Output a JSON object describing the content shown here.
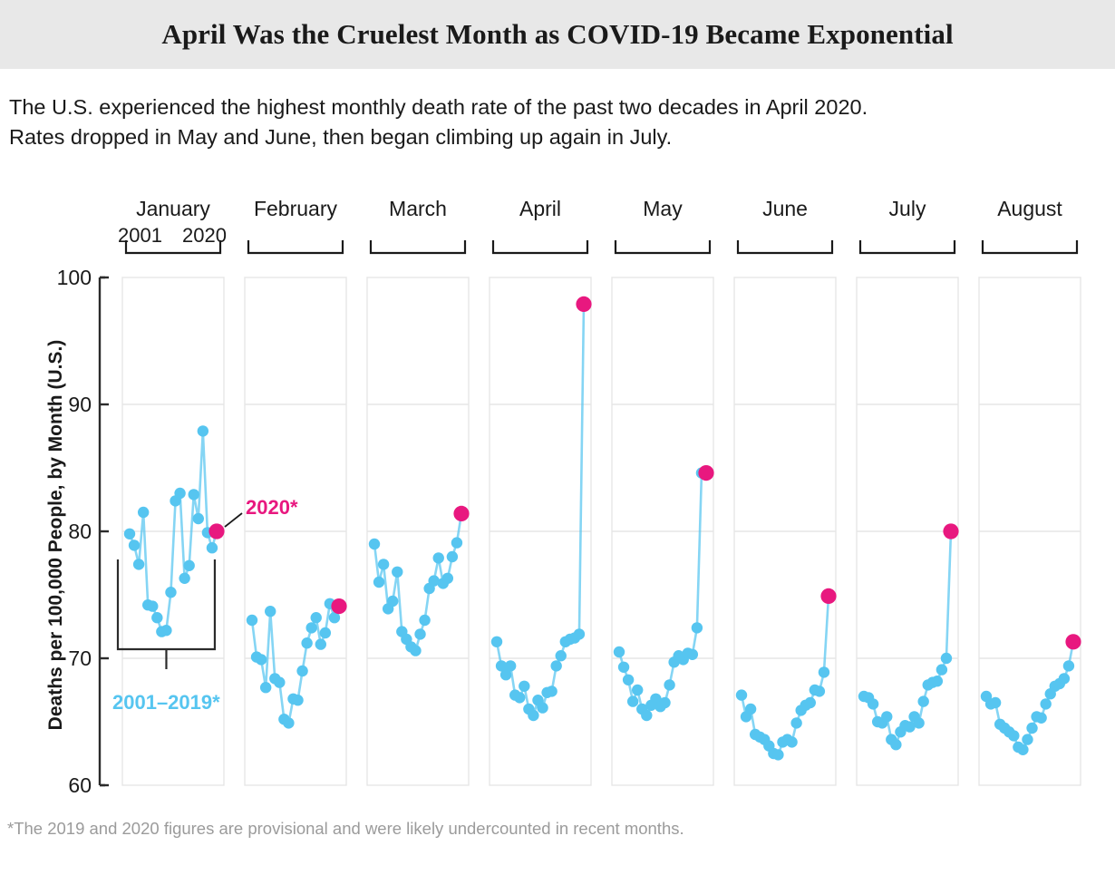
{
  "header": {
    "title": "April Was the Cruelest Month as COVID-19 Became Exponential"
  },
  "deck": {
    "line1": "The U.S. experienced the highest monthly death rate of the past two decades in April 2020.",
    "line2": "Rates dropped in May and June, then began climbing up again in July."
  },
  "footnote": {
    "text": "*The 2019 and 2020 figures are provisional and were likely undercounted in recent months."
  },
  "axis": {
    "y_title": "Deaths per 100,000 People, by Month (U.S.)",
    "y_ticks": [
      "100",
      "90",
      "80",
      "70",
      "60"
    ],
    "year_start_label": "2001",
    "year_end_label": "2020"
  },
  "annotations": {
    "highlight_label": "2020*",
    "range_label": "2001–2019*"
  },
  "colors": {
    "historical": "#56c5f0",
    "highlight": "#e8187f",
    "title_band": "#e8e8e8",
    "grid": "#e6e6e6",
    "axis": "#2b2b2b",
    "footnote": "#9b9b9b"
  },
  "chart_data": {
    "type": "line",
    "title": "April Was the Cruelest Month as COVID-19 Became Exponential",
    "subtitle": "The U.S. experienced the highest monthly death rate of the past two decades in April 2020. Rates dropped in May and June, then began climbing up again in July.",
    "xlabel": "",
    "ylabel": "Deaths per 100,000 People, by Month (U.S.)",
    "ylim": [
      60,
      100
    ],
    "yticks": [
      60,
      70,
      80,
      90,
      100
    ],
    "grid": "horizontal",
    "legend": "none",
    "x": [
      2001,
      2002,
      2003,
      2004,
      2005,
      2006,
      2007,
      2008,
      2009,
      2010,
      2011,
      2012,
      2013,
      2014,
      2015,
      2016,
      2017,
      2018,
      2019,
      2020
    ],
    "panels": [
      {
        "month": "January",
        "values": [
          79.8,
          78.9,
          77.4,
          81.5,
          74.2,
          74.1,
          73.2,
          72.1,
          72.2,
          75.2,
          82.4,
          83.0,
          76.3,
          77.3,
          82.9,
          81.0,
          87.9,
          79.9,
          78.7
        ],
        "highlight_year": 2020,
        "highlight_value": 80.0
      },
      {
        "month": "February",
        "values": [
          73.0,
          70.1,
          69.9,
          67.7,
          73.7,
          68.4,
          68.1,
          65.2,
          64.9,
          66.8,
          66.7,
          69.0,
          71.2,
          72.4,
          73.2,
          71.1,
          72.0,
          74.3,
          73.2
        ],
        "highlight_year": 2020,
        "highlight_value": 74.1
      },
      {
        "month": "March",
        "values": [
          79.0,
          76.0,
          77.4,
          73.9,
          74.5,
          76.8,
          72.1,
          71.5,
          70.9,
          70.6,
          71.9,
          73.0,
          75.5,
          76.1,
          77.9,
          75.9,
          76.3,
          78.0,
          79.1
        ],
        "highlight_year": 2020,
        "highlight_value": 81.4
      },
      {
        "month": "April",
        "values": [
          71.3,
          69.4,
          68.7,
          69.4,
          67.1,
          66.9,
          67.8,
          66.0,
          65.5,
          66.7,
          66.1,
          67.3,
          67.4,
          69.4,
          70.2,
          71.3,
          71.5,
          71.6,
          71.9
        ],
        "highlight_year": 2020,
        "highlight_value": 97.9
      },
      {
        "month": "May",
        "values": [
          70.5,
          69.3,
          68.3,
          66.6,
          67.5,
          66.0,
          65.5,
          66.3,
          66.8,
          66.2,
          66.5,
          67.9,
          69.7,
          70.2,
          69.9,
          70.4,
          70.3,
          72.4,
          84.6
        ],
        "highlight_year": 2020,
        "highlight_value": 84.6
      },
      {
        "month": "June",
        "values": [
          67.1,
          65.4,
          66.0,
          64.0,
          63.8,
          63.6,
          63.1,
          62.5,
          62.4,
          63.4,
          63.6,
          63.4,
          64.9,
          65.9,
          66.3,
          66.5,
          67.5,
          67.4,
          68.9
        ],
        "highlight_year": 2020,
        "highlight_value": 74.9
      },
      {
        "month": "July",
        "values": [
          67.0,
          66.9,
          66.4,
          65.0,
          64.9,
          65.4,
          63.6,
          63.2,
          64.2,
          64.7,
          64.6,
          65.4,
          64.9,
          66.6,
          67.9,
          68.1,
          68.2,
          69.1,
          70.0
        ],
        "highlight_year": 2020,
        "highlight_value": 80.0
      },
      {
        "month": "August",
        "values": [
          67.0,
          66.4,
          66.5,
          64.8,
          64.5,
          64.2,
          63.9,
          63.0,
          62.8,
          63.6,
          64.5,
          65.4,
          65.3,
          66.4,
          67.2,
          67.8,
          68.0,
          68.4,
          69.4
        ],
        "highlight_year": 2020,
        "highlight_value": 71.3
      }
    ]
  }
}
